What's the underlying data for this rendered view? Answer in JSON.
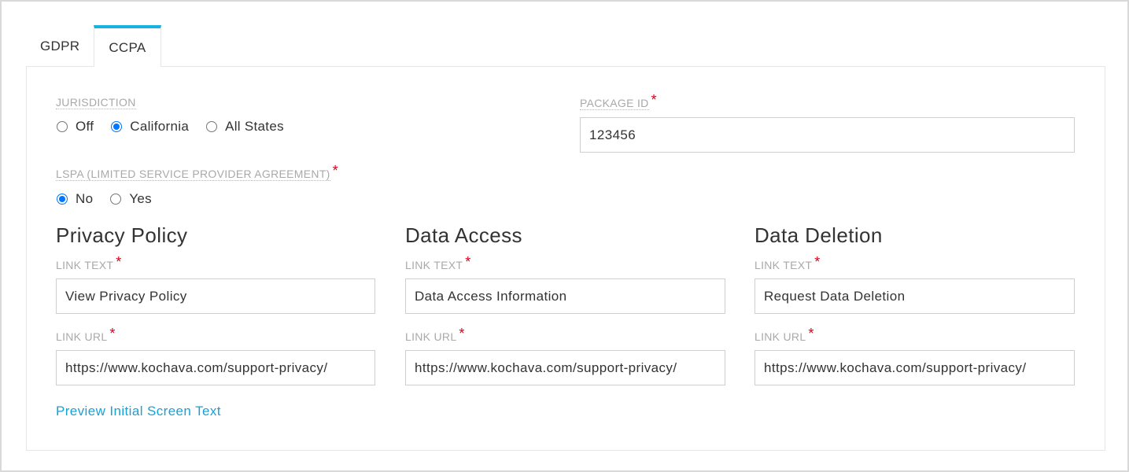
{
  "tabs": [
    {
      "label": "GDPR",
      "active": false
    },
    {
      "label": "CCPA",
      "active": true
    }
  ],
  "jurisdiction": {
    "label": "JURISDICTION",
    "options": [
      {
        "label": "Off",
        "checked": false
      },
      {
        "label": "California",
        "checked": true
      },
      {
        "label": "All States",
        "checked": false
      }
    ]
  },
  "package_id": {
    "label": "PACKAGE ID",
    "required_mark": "*",
    "value": "123456"
  },
  "lspa": {
    "label": "LSPA (LIMITED SERVICE PROVIDER AGREEMENT)",
    "required_mark": "*",
    "options": [
      {
        "label": "No",
        "checked": true
      },
      {
        "label": "Yes",
        "checked": false
      }
    ]
  },
  "sections": [
    {
      "title": "Privacy Policy",
      "link_text_label": "LINK TEXT",
      "link_text_value": "View Privacy Policy",
      "link_url_label": "LINK URL",
      "link_url_value": "https://www.kochava.com/support-privacy/"
    },
    {
      "title": "Data Access",
      "link_text_label": "LINK TEXT",
      "link_text_value": "Data Access Information",
      "link_url_label": "LINK URL",
      "link_url_value": "https://www.kochava.com/support-privacy/"
    },
    {
      "title": "Data Deletion",
      "link_text_label": "LINK TEXT",
      "link_text_value": "Request Data Deletion",
      "link_url_label": "LINK URL",
      "link_url_value": "https://www.kochava.com/support-privacy/"
    }
  ],
  "preview_link": "Preview Initial Screen Text",
  "required_mark": "*",
  "colors": {
    "accent": "#17b2df",
    "link": "#17a2d6",
    "required": "#d0021b",
    "radio_checked": "#0075ff"
  }
}
